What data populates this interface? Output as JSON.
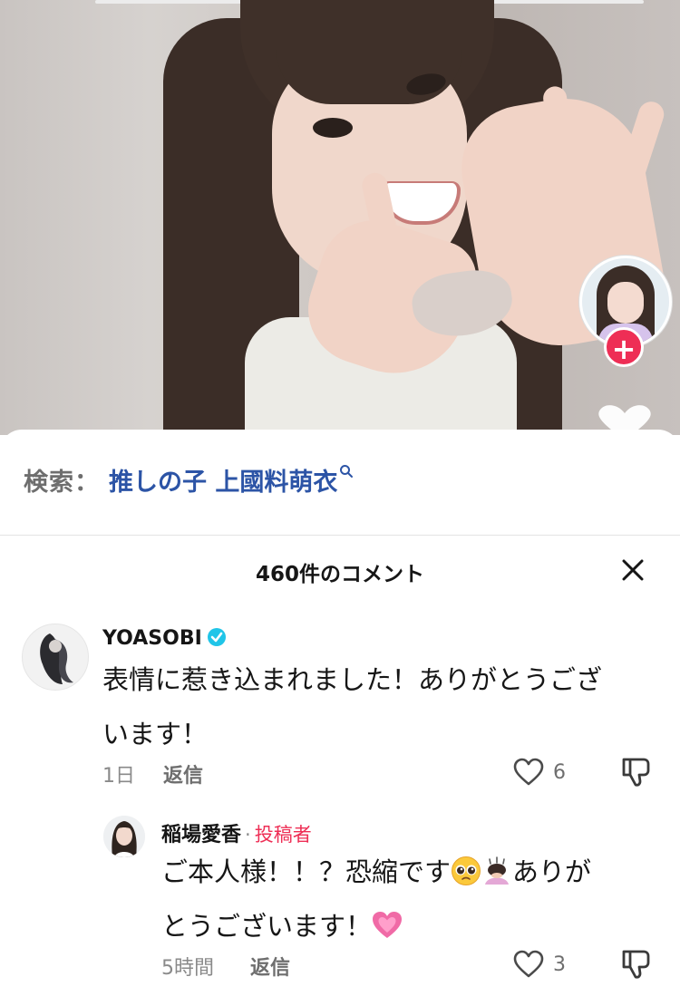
{
  "video": {
    "creator_avatar_icon": "creator-avatar",
    "follow_icon": "plus-icon",
    "like_icon": "heart-icon"
  },
  "search": {
    "label": "検索：",
    "query": "推しの子 上國料萌衣",
    "icon": "search-icon"
  },
  "comments_header": {
    "title": "460件のコメント",
    "close_icon": "close-icon"
  },
  "comments": [
    {
      "username": "YOASOBI",
      "verified": true,
      "text_line1": "表情に惹き込まれました！ありがとうござ",
      "text_line2": "います！",
      "time": "1日",
      "reply_label": "返信",
      "likes": "6"
    }
  ],
  "replies": [
    {
      "username": "稲場愛香",
      "separator": "·",
      "author_tag": "投稿者",
      "text_line1_a": "ご本人様！！？恐縮です",
      "text_line1_b": "ありが",
      "text_line2": "とうございます！",
      "time": "5時間",
      "reply_label": "返信",
      "likes": "3"
    }
  ],
  "colors": {
    "accent_red": "#ee2e55",
    "link_blue": "#2c54a6",
    "verified": "#20c5e8"
  }
}
